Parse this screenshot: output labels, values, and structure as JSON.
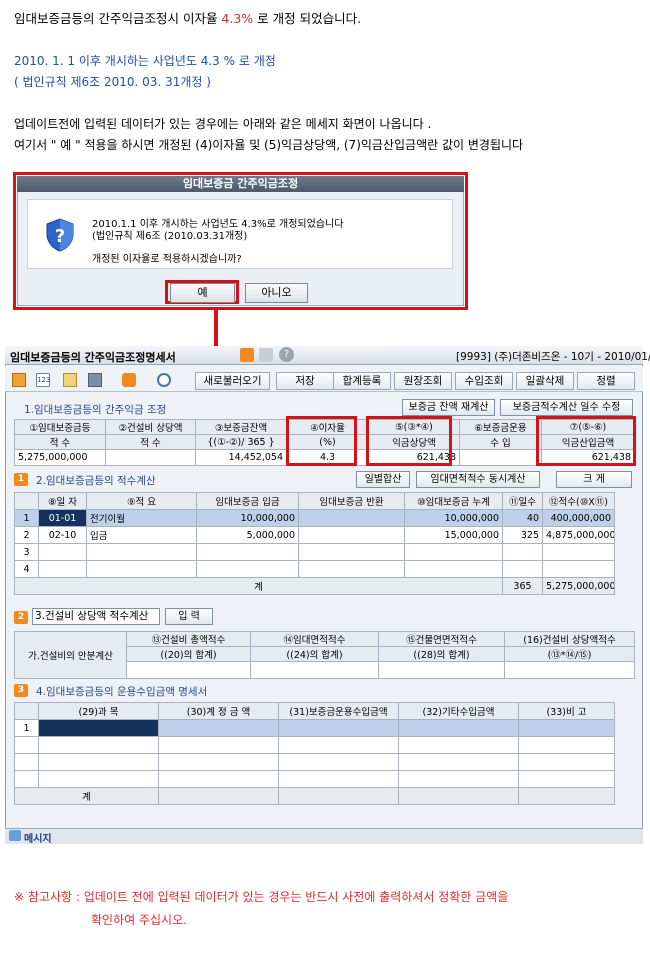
{
  "intro": {
    "line1_a": "임대보증금등의 간주익금조정시 이자율 ",
    "line1_rate": "4.3%",
    "line1_b": " 로 개정 되었습니다.",
    "line2": "2010. 1. 1 이후 개시하는 사업년도 4.3 % 로 개정",
    "line3": "( 법인규칙 제6조 2010. 03. 31개정 )",
    "line4": "업데이트전에 입력된 데이터가 있는 경우에는 아래와 같은 메세지 화면이 나옵니다 .",
    "line5": "여기서 \" 예 \" 적용을 하시면 개정된 (4)이자율 및 (5)익금상당액, (7)익금산입금액란 값이 변경됩니다"
  },
  "dialog": {
    "title": "임대보증금 간주익금조정",
    "msg1": "2010.1.1 이후 개시하는 사업년도 4.3%로 개정되었습니다",
    "msg2": "(법인규칙 제6조 (2010.03.31개정)",
    "msg3": "개정된 이자율로 적용하시겠습니까?",
    "yes": "예",
    "no": "아니오"
  },
  "app": {
    "title": "임대보증금등의 간주익금조정명세서",
    "info": "[9993] (주)더존비즈온 - 10기 - 2010/01/0",
    "toolbar": [
      "새로불러오기",
      "저장",
      "합계등록",
      "원장조회",
      "수입조회",
      "일괄삭제",
      "정렬"
    ],
    "icons": [
      "close-icon",
      "calculator-icon",
      "copy-icon",
      "print-icon",
      "add-icon",
      "search-icon"
    ],
    "s1": {
      "title": "1.임대보증금등의 간주익금 조정",
      "btn1": "보증금 잔액 재계산",
      "btn2": "보증금적수계산 일수 수정",
      "h1a": "①임대보증금등",
      "h1b": "적                수",
      "h2a": "②건설비 상당액",
      "h2b": "적                수",
      "h3a": "③보증금잔액",
      "h3b": "{(①-②)/ 365 }",
      "h4a": "④이자율",
      "h4b": "(%)",
      "h5a": "⑤(③*④)",
      "h5b": "익금상당액",
      "h6a": "⑥보증금운용",
      "h6b": "수             입",
      "h7a": "⑦(⑤-⑥)",
      "h7b": "익금산입금액",
      "v1": "5,275,000,000",
      "v2": "",
      "v3": "14,452,054",
      "v4": "4.3",
      "v5": "621,438",
      "v6": "",
      "v7": "621,438"
    },
    "s2": {
      "num": "1",
      "title": "2.임대보증금등의 적수계산",
      "btn1": "일별합산",
      "btn2": "임대면적적수 동시계산",
      "btn3": "크 게",
      "headers": [
        "⑧일 자",
        "⑨적        요",
        "임대보증금 입금",
        "임대보증금 반환",
        "⑩임대보증금 누계",
        "⑪일수",
        "⑫적수(⑩X⑪)"
      ],
      "rows": [
        {
          "no": "1",
          "date": "01-01",
          "desc": "전기이월",
          "in": "10,000,000",
          "out": "",
          "sum": "10,000,000",
          "days": "40",
          "acc": "400,000,000"
        },
        {
          "no": "2",
          "date": "02-10",
          "desc": "입금",
          "in": "5,000,000",
          "out": "",
          "sum": "15,000,000",
          "days": "325",
          "acc": "4,875,000,000"
        },
        {
          "no": "3",
          "date": "",
          "desc": "",
          "in": "",
          "out": "",
          "sum": "",
          "days": "",
          "acc": ""
        },
        {
          "no": "4",
          "date": "",
          "desc": "",
          "in": "",
          "out": "",
          "sum": "",
          "days": "",
          "acc": ""
        }
      ],
      "total_label": "계",
      "total_days": "365",
      "total_acc": "5,275,000,000"
    },
    "s3": {
      "num": "2",
      "title": "3.건설비 상당액 적수계산",
      "btn": "입 력",
      "row_label": "가.건설비의 안분계산",
      "h1a": "⑬건설비 총액적수",
      "h1b": "((20)의 합계)",
      "h2a": "⑭임대면적적수",
      "h2b": "((24)의 합계)",
      "h3a": "⑮건물연면적적수",
      "h3b": "((28)의 합계)",
      "h4a": "(16)건설비 상당액적수",
      "h4b": "(⑬*⑭/⑮)"
    },
    "s4": {
      "num": "3",
      "title": "4.임대보증금등의 운용수입금액 명세서",
      "headers": [
        "(29)과            목",
        "(30)계 정 금 액",
        "(31)보증금운용수입금액",
        "(32)기타수입금액",
        "(33)비      고"
      ],
      "row1": "1",
      "total": "계"
    },
    "msgbar": "메시지"
  },
  "note": {
    "line1": "※ 참고사항 : 업데이트 전에 입력된 데이터가 있는 경우는 반드시 사전에 출력하셔서 정확한 금액을",
    "line2": "확인하여 주십시오."
  }
}
